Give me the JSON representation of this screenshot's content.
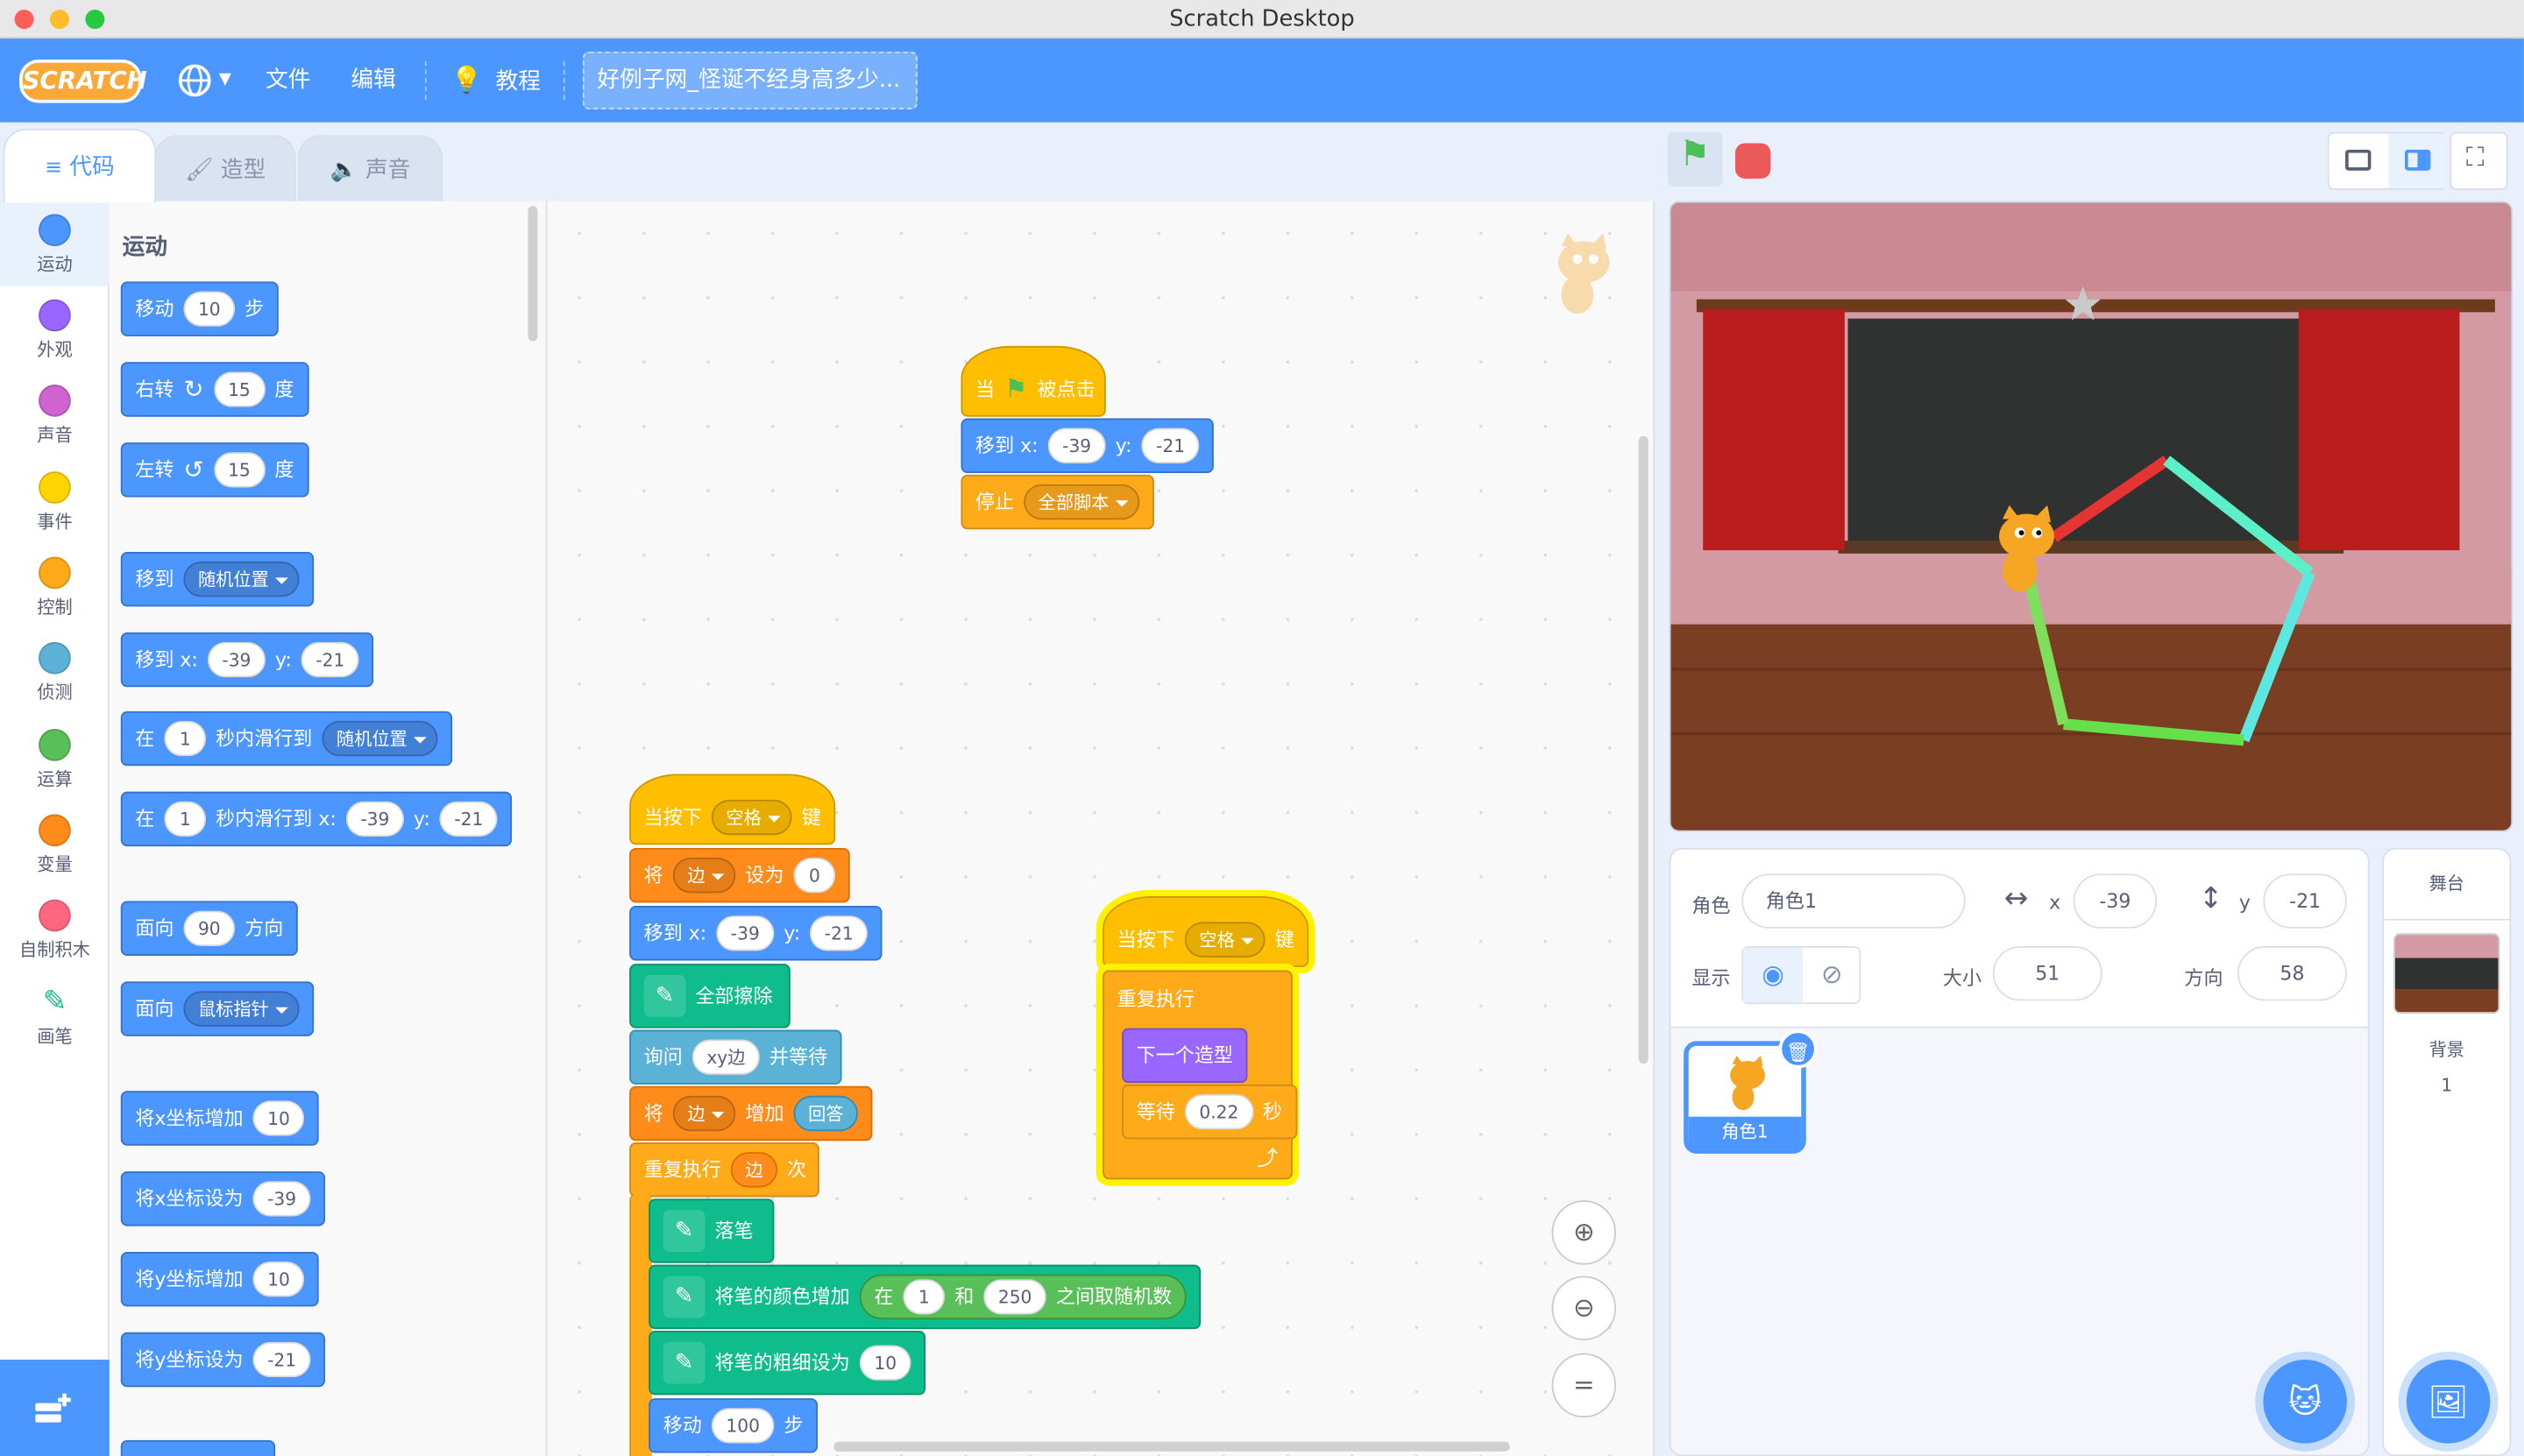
{
  "window": {
    "title": "Scratch Desktop"
  },
  "menubar": {
    "logo": "SCRATCH",
    "file": "文件",
    "edit": "编辑",
    "tutorials": "教程",
    "project_title": "好例子网_怪诞不经身高多少..."
  },
  "tabs": {
    "code": "代码",
    "costumes": "造型",
    "sounds": "声音"
  },
  "categories": [
    {
      "label": "运动",
      "color": "#4c97ff"
    },
    {
      "label": "外观",
      "color": "#9966ff"
    },
    {
      "label": "声音",
      "color": "#cf63cf"
    },
    {
      "label": "事件",
      "color": "#ffd500"
    },
    {
      "label": "控制",
      "color": "#ffab19"
    },
    {
      "label": "侦测",
      "color": "#5cb1d6"
    },
    {
      "label": "运算",
      "color": "#59c059"
    },
    {
      "label": "变量",
      "color": "#ff8c1a"
    },
    {
      "label": "自制积木",
      "color": "#ff6680"
    },
    {
      "label": "画笔",
      "color": "#0fbd8c"
    }
  ],
  "palette": {
    "heading": "运动",
    "move": {
      "a": "移动",
      "n": "10",
      "b": "步"
    },
    "turn_right": {
      "a": "右转",
      "n": "15",
      "b": "度"
    },
    "turn_left": {
      "a": "左转",
      "n": "15",
      "b": "度"
    },
    "goto": {
      "a": "移到",
      "dd": "随机位置"
    },
    "goto_xy": {
      "a": "移到 x:",
      "x": "-39",
      "yl": "y:",
      "y": "-21"
    },
    "glide": {
      "a": "在",
      "n": "1",
      "b": "秒内滑行到",
      "dd": "随机位置"
    },
    "glide_xy": {
      "a": "在",
      "n": "1",
      "b": "秒内滑行到 x:",
      "x": "-39",
      "yl": "y:",
      "y": "-21"
    },
    "point_dir": {
      "a": "面向",
      "n": "90",
      "b": "方向"
    },
    "point_towards": {
      "a": "面向",
      "dd": "鼠标指针"
    },
    "change_x": {
      "a": "将x坐标增加",
      "n": "10"
    },
    "set_x": {
      "a": "将x坐标设为",
      "n": "-39"
    },
    "change_y": {
      "a": "将y坐标增加",
      "n": "10"
    },
    "set_y": {
      "a": "将y坐标设为",
      "n": "-21"
    }
  },
  "script1": {
    "hat_a": "当",
    "hat_b": "被点击",
    "goto_a": "移到 x:",
    "goto_x": "-39",
    "goto_yl": "y:",
    "goto_y": "-21",
    "stop_a": "停止",
    "stop_dd": "全部脚本"
  },
  "script2": {
    "hat_a": "当按下",
    "hat_dd": "空格",
    "hat_b": "键",
    "set_a": "将",
    "set_dd": "边",
    "set_b": "设为",
    "set_n": "0",
    "goto_a": "移到 x:",
    "goto_x": "-39",
    "goto_yl": "y:",
    "goto_y": "-21",
    "clear": "全部擦除",
    "ask_a": "询问",
    "ask_n": "xy边",
    "ask_b": "并等待",
    "change_a": "将",
    "change_dd": "边",
    "change_b": "增加",
    "change_ans": "回答",
    "repeat_a": "重复执行",
    "repeat_var": "边",
    "repeat_b": "次",
    "pendown": "落笔",
    "color_a": "将笔的颜色增加",
    "rand_a": "在",
    "rand_n1": "1",
    "rand_b": "和",
    "rand_n2": "250",
    "rand_c": "之间取随机数",
    "size_a": "将笔的粗细设为",
    "size_n": "10",
    "move_a": "移动",
    "move_n": "100",
    "move_b": "步"
  },
  "script3": {
    "hat_a": "当按下",
    "hat_dd": "空格",
    "hat_b": "键",
    "forever": "重复执行",
    "next": "下一个造型",
    "wait_a": "等待",
    "wait_n": "0.22",
    "wait_b": "秒"
  },
  "sprite_info": {
    "sprite_label": "角色",
    "sprite_name": "角色1",
    "x_label": "x",
    "x": "-39",
    "y_label": "y",
    "y": "-21",
    "show_label": "显示",
    "size_label": "大小",
    "size": "51",
    "direction_label": "方向",
    "direction": "58"
  },
  "sprites": [
    {
      "name": "角色1"
    }
  ],
  "stage_panel": {
    "title": "舞台",
    "backdrops_label": "背景",
    "backdrops_count": "1"
  }
}
